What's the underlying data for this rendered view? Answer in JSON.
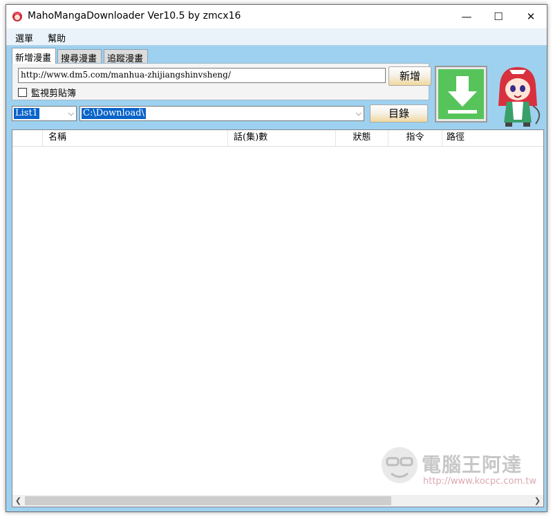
{
  "window": {
    "title": "MahoMangaDownloader Ver10.5 by zmcx16"
  },
  "controls": {
    "minimize": "—",
    "maximize": "☐",
    "close": "✕"
  },
  "menu": [
    "選單",
    "幫助"
  ],
  "tabs": [
    "新增漫畫",
    "搜尋漫畫",
    "追蹤漫畫"
  ],
  "add_panel": {
    "url_value": "http://www.dm5.com/manhua-zhijiangshinvsheng/",
    "add_button": "新增",
    "monitor_clipboard_label": "監視剪貼簿",
    "monitor_clipboard_checked": false
  },
  "list_select": {
    "value": "List1"
  },
  "path_select": {
    "value": "C:\\Download\\"
  },
  "dir_button": "目錄",
  "table": {
    "columns": [
      "",
      "名稱",
      "話(集)數",
      "狀態",
      "指令",
      "路徑"
    ],
    "rows": []
  },
  "watermark": {
    "title": "電腦王阿達",
    "url": "http://www.kocpc.com.tw"
  },
  "colors": {
    "window_bg": "#9ed1ef",
    "download_green": "#56c45a",
    "selection": "#0a64c8"
  }
}
